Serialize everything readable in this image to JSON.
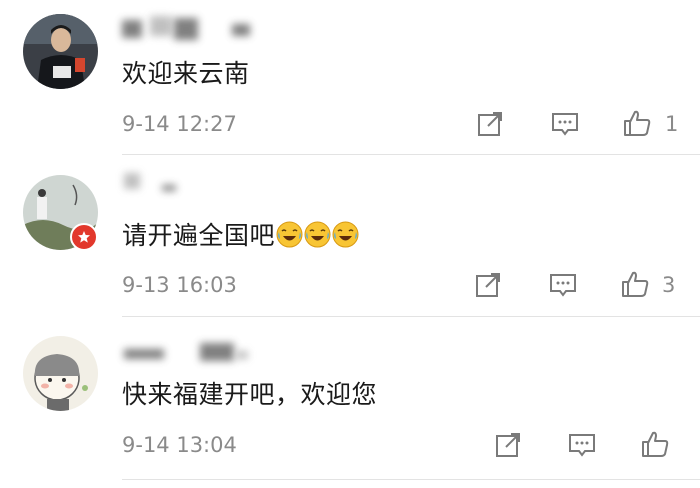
{
  "comments": [
    {
      "text": "欢迎来云南",
      "time": "9-14 12:27",
      "likes": "1",
      "emojis": []
    },
    {
      "text": "请开遍全国吧",
      "time": "9-13 16:03",
      "likes": "3",
      "emojis": [
        "laugh-cry-emoji",
        "laugh-cry-emoji",
        "laugh-cry-emoji"
      ]
    },
    {
      "text": "快来福建开吧，欢迎您",
      "time": "9-14 13:04",
      "likes": "",
      "emojis": []
    }
  ],
  "icons": {
    "share": "share-icon",
    "comment": "comment-icon",
    "like": "thumbs-up-icon"
  },
  "colors": {
    "meta_text": "#8a8a8a",
    "badge": "#e2382c",
    "divider": "#e3e3e3"
  }
}
